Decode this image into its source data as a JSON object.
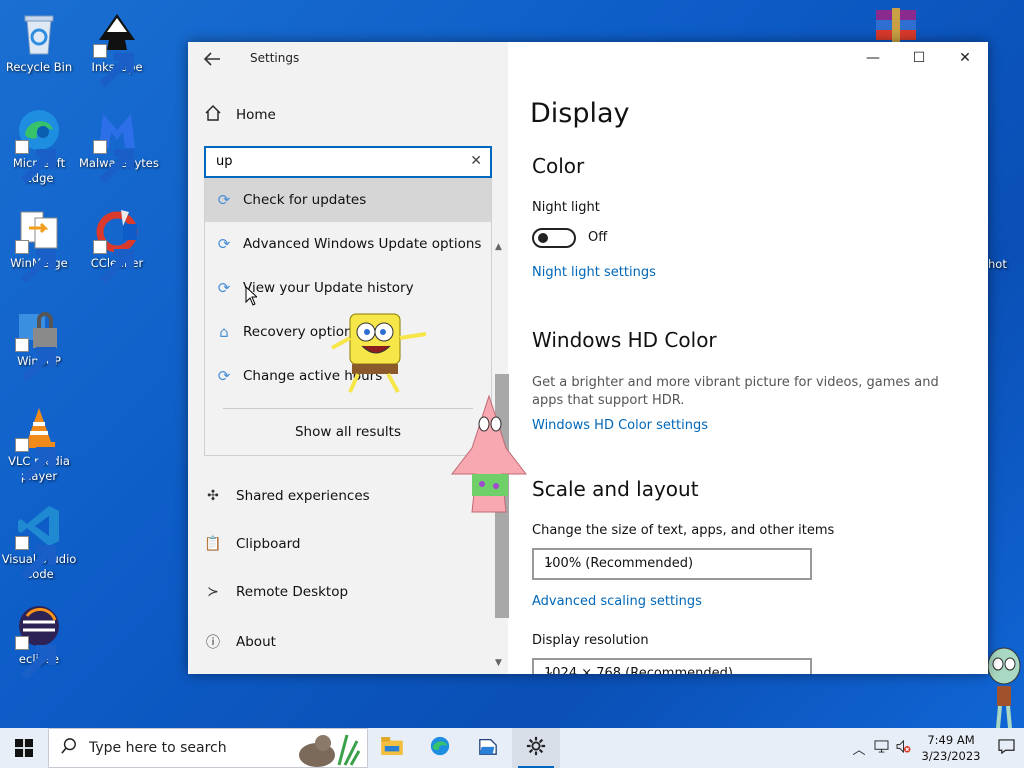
{
  "desktop": {
    "icons": [
      {
        "label": "Recycle Bin"
      },
      {
        "label": "Inkscape"
      },
      {
        "label": "Microsoft Edge"
      },
      {
        "label": "Malwarebytes"
      },
      {
        "label": "WinMerge"
      },
      {
        "label": "CCleaner"
      },
      {
        "label": "WinSCP"
      },
      {
        "label": "VLC media player"
      },
      {
        "label": "Visual Studio Code"
      },
      {
        "label": "eclipse"
      }
    ],
    "partial_right_label": "hot"
  },
  "window": {
    "title": "Settings",
    "controls": {
      "minimize": "—",
      "maximize": "☐",
      "close": "✕"
    }
  },
  "nav": {
    "home_label": "Home",
    "search": {
      "value": "up",
      "clear_icon": "✕"
    },
    "dropdown": {
      "items": [
        {
          "label": "Check for updates",
          "icon": "refresh-icon"
        },
        {
          "label": "Advanced Windows Update options",
          "icon": "refresh-icon"
        },
        {
          "label": "View your Update history",
          "icon": "refresh-icon"
        },
        {
          "label": "Recovery options",
          "icon": "recovery-icon"
        },
        {
          "label": "Change active hours",
          "icon": "refresh-icon"
        }
      ],
      "show_all_label": "Show all results"
    },
    "items": [
      {
        "label": "Shared experiences",
        "icon": "shared-experiences-icon"
      },
      {
        "label": "Clipboard",
        "icon": "clipboard-icon"
      },
      {
        "label": "Remote Desktop",
        "icon": "remote-desktop-icon"
      },
      {
        "label": "About",
        "icon": "info-icon"
      }
    ]
  },
  "content": {
    "page_title": "Display",
    "color_heading": "Color",
    "night_light_label": "Night light",
    "night_light_state": "Off",
    "night_light_settings_link": "Night light settings",
    "hd_color_heading": "Windows HD Color",
    "hd_color_desc": "Get a brighter and more vibrant picture for videos, games and apps that support HDR.",
    "hd_color_link": "Windows HD Color settings",
    "scale_heading": "Scale and layout",
    "scale_label": "Change the size of text, apps, and other items",
    "scale_value": "100% (Recommended)",
    "advanced_scaling_link": "Advanced scaling settings",
    "resolution_label": "Display resolution",
    "resolution_value": "1024 × 768 (Recommended)"
  },
  "taskbar": {
    "search_placeholder": "Type here to search",
    "clock_time": "7:49 AM",
    "clock_date": "3/23/2023",
    "apps": [
      "file-explorer-icon",
      "edge-icon",
      "folder-doc-icon",
      "settings-icon"
    ]
  },
  "colors": {
    "accent": "#0067c0",
    "link": "#0067b8",
    "desktop": "#0d5cc7"
  }
}
